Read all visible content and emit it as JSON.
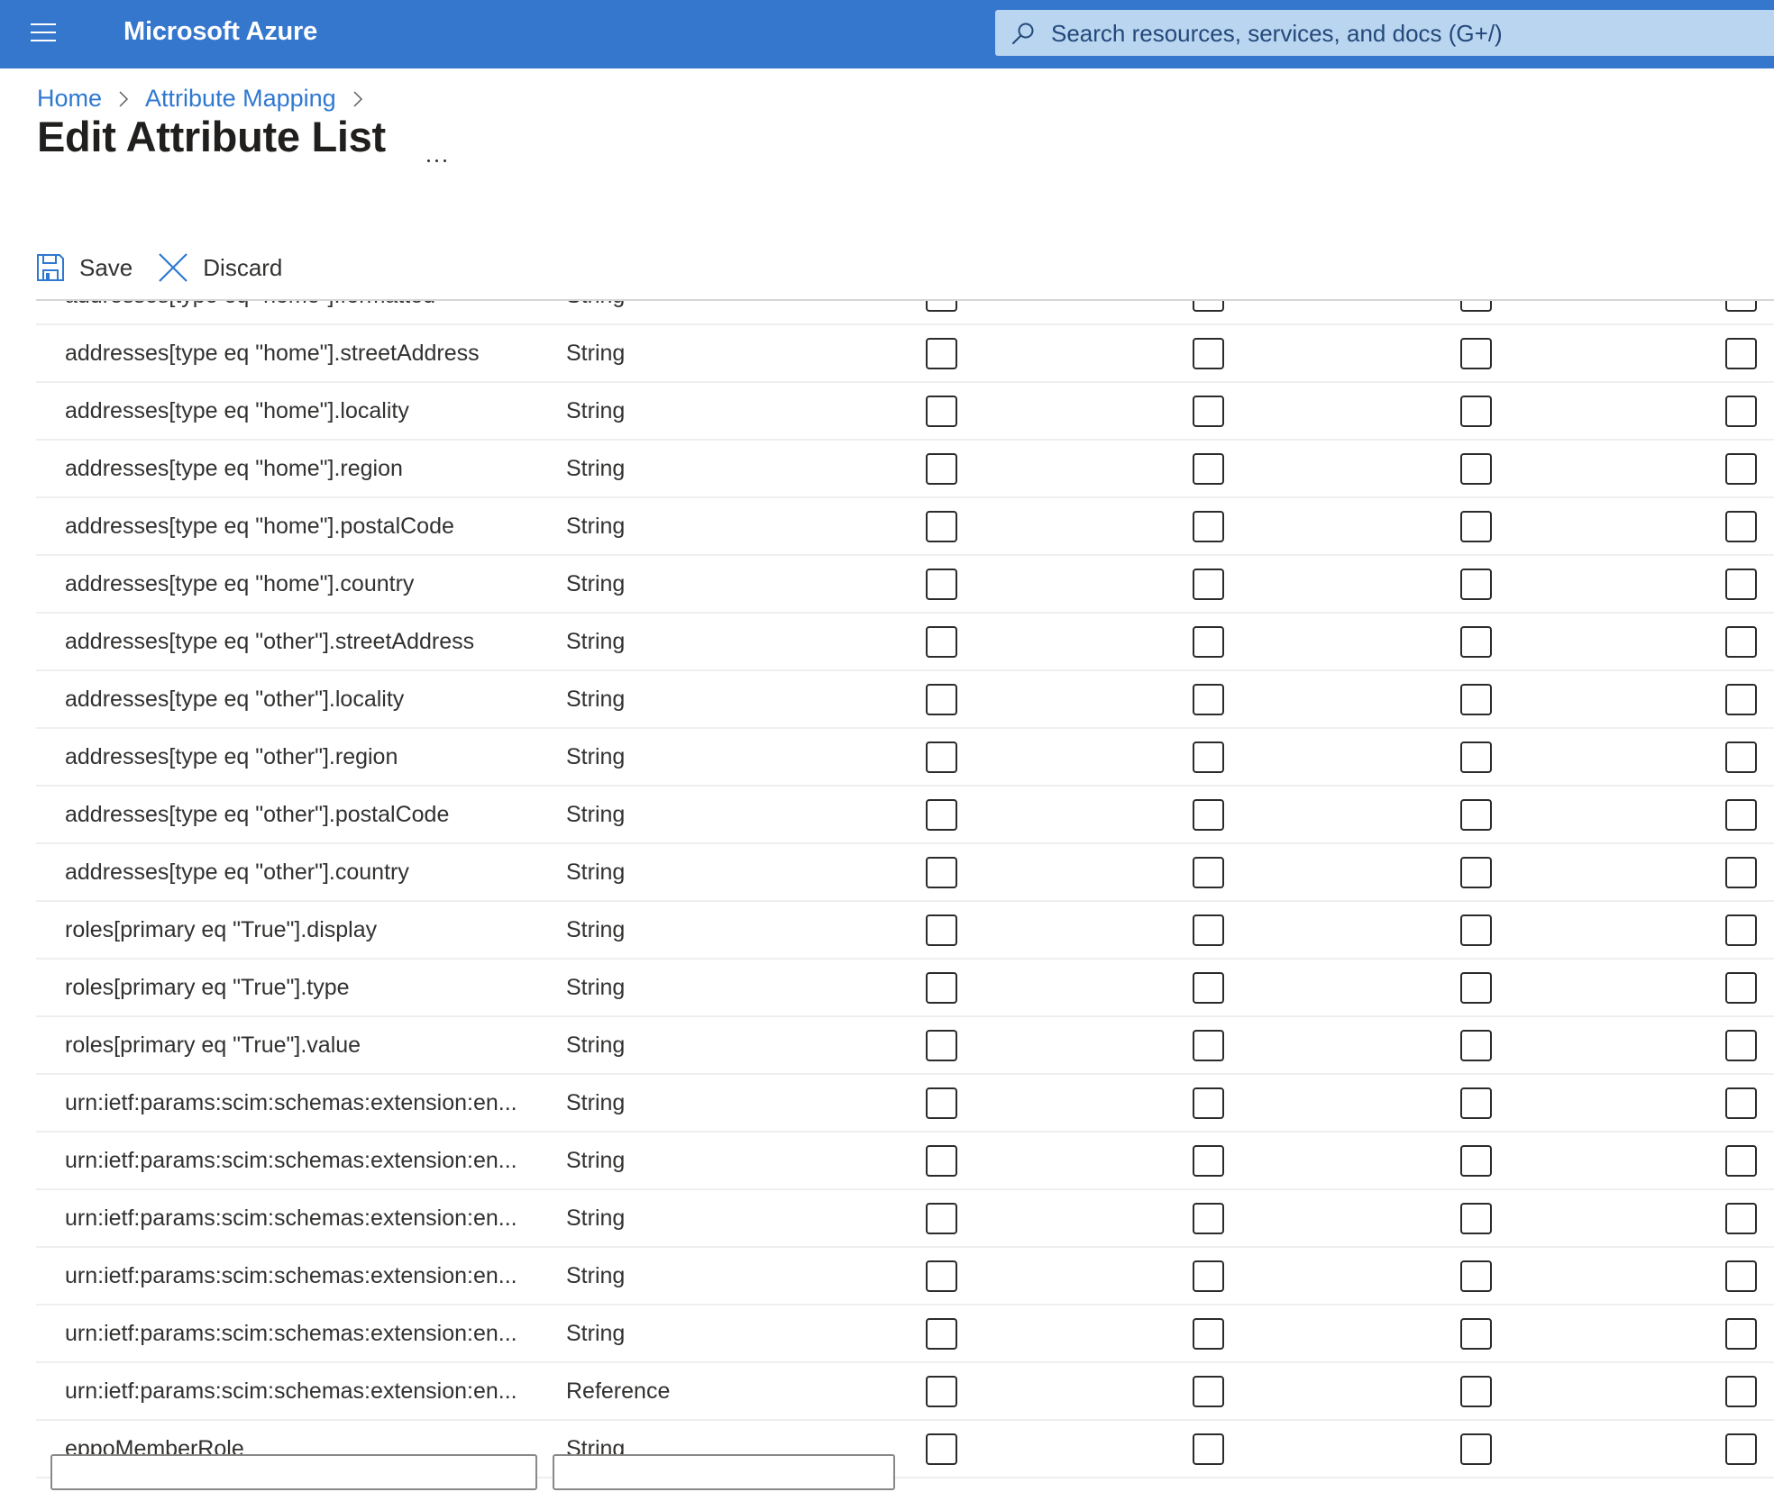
{
  "header": {
    "menu_icon": "hamburger-menu-icon",
    "brand": "Microsoft Azure",
    "search": {
      "icon": "search-icon",
      "placeholder": "Search resources, services, and docs (G+/)",
      "value": ""
    }
  },
  "breadcrumb": [
    {
      "label": "Home"
    },
    {
      "label": "Attribute Mapping"
    }
  ],
  "page": {
    "title": "Edit Attribute List",
    "more_icon": "ellipsis-icon"
  },
  "toolbar": {
    "save_label": "Save",
    "save_icon": "save-floppy-icon",
    "discard_label": "Discard",
    "discard_icon": "close-x-icon"
  },
  "colors": {
    "header_bg": "#3577cd",
    "search_bg": "#bad5f0",
    "link": "#2f78d1",
    "icon_accent": "#2f78d1"
  },
  "attributes": [
    {
      "name": "addresses[type eq \"home\"].formatted",
      "type": "String",
      "checks": [
        false,
        false,
        false,
        false
      ]
    },
    {
      "name": "addresses[type eq \"home\"].streetAddress",
      "type": "String",
      "checks": [
        false,
        false,
        false,
        false
      ]
    },
    {
      "name": "addresses[type eq \"home\"].locality",
      "type": "String",
      "checks": [
        false,
        false,
        false,
        false
      ]
    },
    {
      "name": "addresses[type eq \"home\"].region",
      "type": "String",
      "checks": [
        false,
        false,
        false,
        false
      ]
    },
    {
      "name": "addresses[type eq \"home\"].postalCode",
      "type": "String",
      "checks": [
        false,
        false,
        false,
        false
      ]
    },
    {
      "name": "addresses[type eq \"home\"].country",
      "type": "String",
      "checks": [
        false,
        false,
        false,
        false
      ]
    },
    {
      "name": "addresses[type eq \"other\"].streetAddress",
      "type": "String",
      "checks": [
        false,
        false,
        false,
        false
      ]
    },
    {
      "name": "addresses[type eq \"other\"].locality",
      "type": "String",
      "checks": [
        false,
        false,
        false,
        false
      ]
    },
    {
      "name": "addresses[type eq \"other\"].region",
      "type": "String",
      "checks": [
        false,
        false,
        false,
        false
      ]
    },
    {
      "name": "addresses[type eq \"other\"].postalCode",
      "type": "String",
      "checks": [
        false,
        false,
        false,
        false
      ]
    },
    {
      "name": "addresses[type eq \"other\"].country",
      "type": "String",
      "checks": [
        false,
        false,
        false,
        false
      ]
    },
    {
      "name": "roles[primary eq \"True\"].display",
      "type": "String",
      "checks": [
        false,
        false,
        false,
        false
      ]
    },
    {
      "name": "roles[primary eq \"True\"].type",
      "type": "String",
      "checks": [
        false,
        false,
        false,
        false
      ]
    },
    {
      "name": "roles[primary eq \"True\"].value",
      "type": "String",
      "checks": [
        false,
        false,
        false,
        false
      ]
    },
    {
      "name": "urn:ietf:params:scim:schemas:extension:en...",
      "type": "String",
      "checks": [
        false,
        false,
        false,
        false
      ]
    },
    {
      "name": "urn:ietf:params:scim:schemas:extension:en...",
      "type": "String",
      "checks": [
        false,
        false,
        false,
        false
      ]
    },
    {
      "name": "urn:ietf:params:scim:schemas:extension:en...",
      "type": "String",
      "checks": [
        false,
        false,
        false,
        false
      ]
    },
    {
      "name": "urn:ietf:params:scim:schemas:extension:en...",
      "type": "String",
      "checks": [
        false,
        false,
        false,
        false
      ]
    },
    {
      "name": "urn:ietf:params:scim:schemas:extension:en...",
      "type": "String",
      "checks": [
        false,
        false,
        false,
        false
      ]
    },
    {
      "name": "urn:ietf:params:scim:schemas:extension:en...",
      "type": "Reference",
      "checks": [
        false,
        false,
        false,
        false
      ]
    },
    {
      "name": "eppoMemberRole",
      "type": "String",
      "checks": [
        false,
        false,
        false,
        false
      ]
    }
  ],
  "new_attribute": {
    "name_value": "",
    "type_value": ""
  }
}
